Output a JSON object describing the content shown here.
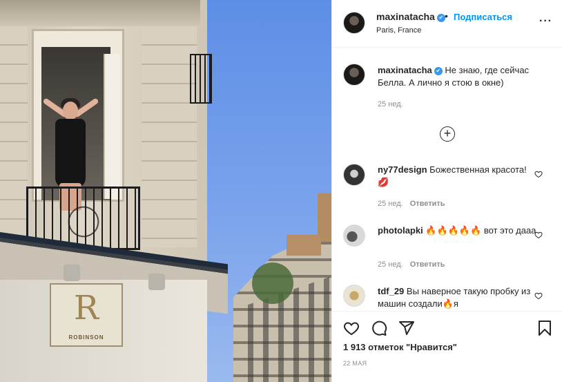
{
  "post": {
    "username": "maxinatacha",
    "verified": "✔",
    "dot": "•",
    "follow_label": "Подписаться",
    "location": "Paris, France",
    "more_label": "···"
  },
  "photo": {
    "sign_letter": "R",
    "sign_text": "ROBINSON"
  },
  "caption": {
    "username": "maxinatacha",
    "text": "Не знаю, где сейчас Белла. А лично я стою в окне)",
    "time": "25 нед."
  },
  "load_more_label": "+",
  "comments": [
    {
      "username": "ny77design",
      "text": "Божественная красота! 💋",
      "time": "25 нед.",
      "reply": "Ответить"
    },
    {
      "username": "photolapki",
      "text": "🔥🔥🔥🔥🔥 вот это дааа",
      "time": "25 нед.",
      "reply": "Ответить"
    },
    {
      "username": "tdf_29",
      "text": "Вы наверное такую пробку из машин создали🔥я",
      "time": "",
      "reply": ""
    }
  ],
  "likes_text": "1 913 отметок \"Нравится\"",
  "date_text": "22 МАЯ",
  "icons": [
    "heart-icon",
    "comment-icon",
    "share-icon",
    "bookmark-icon"
  ]
}
